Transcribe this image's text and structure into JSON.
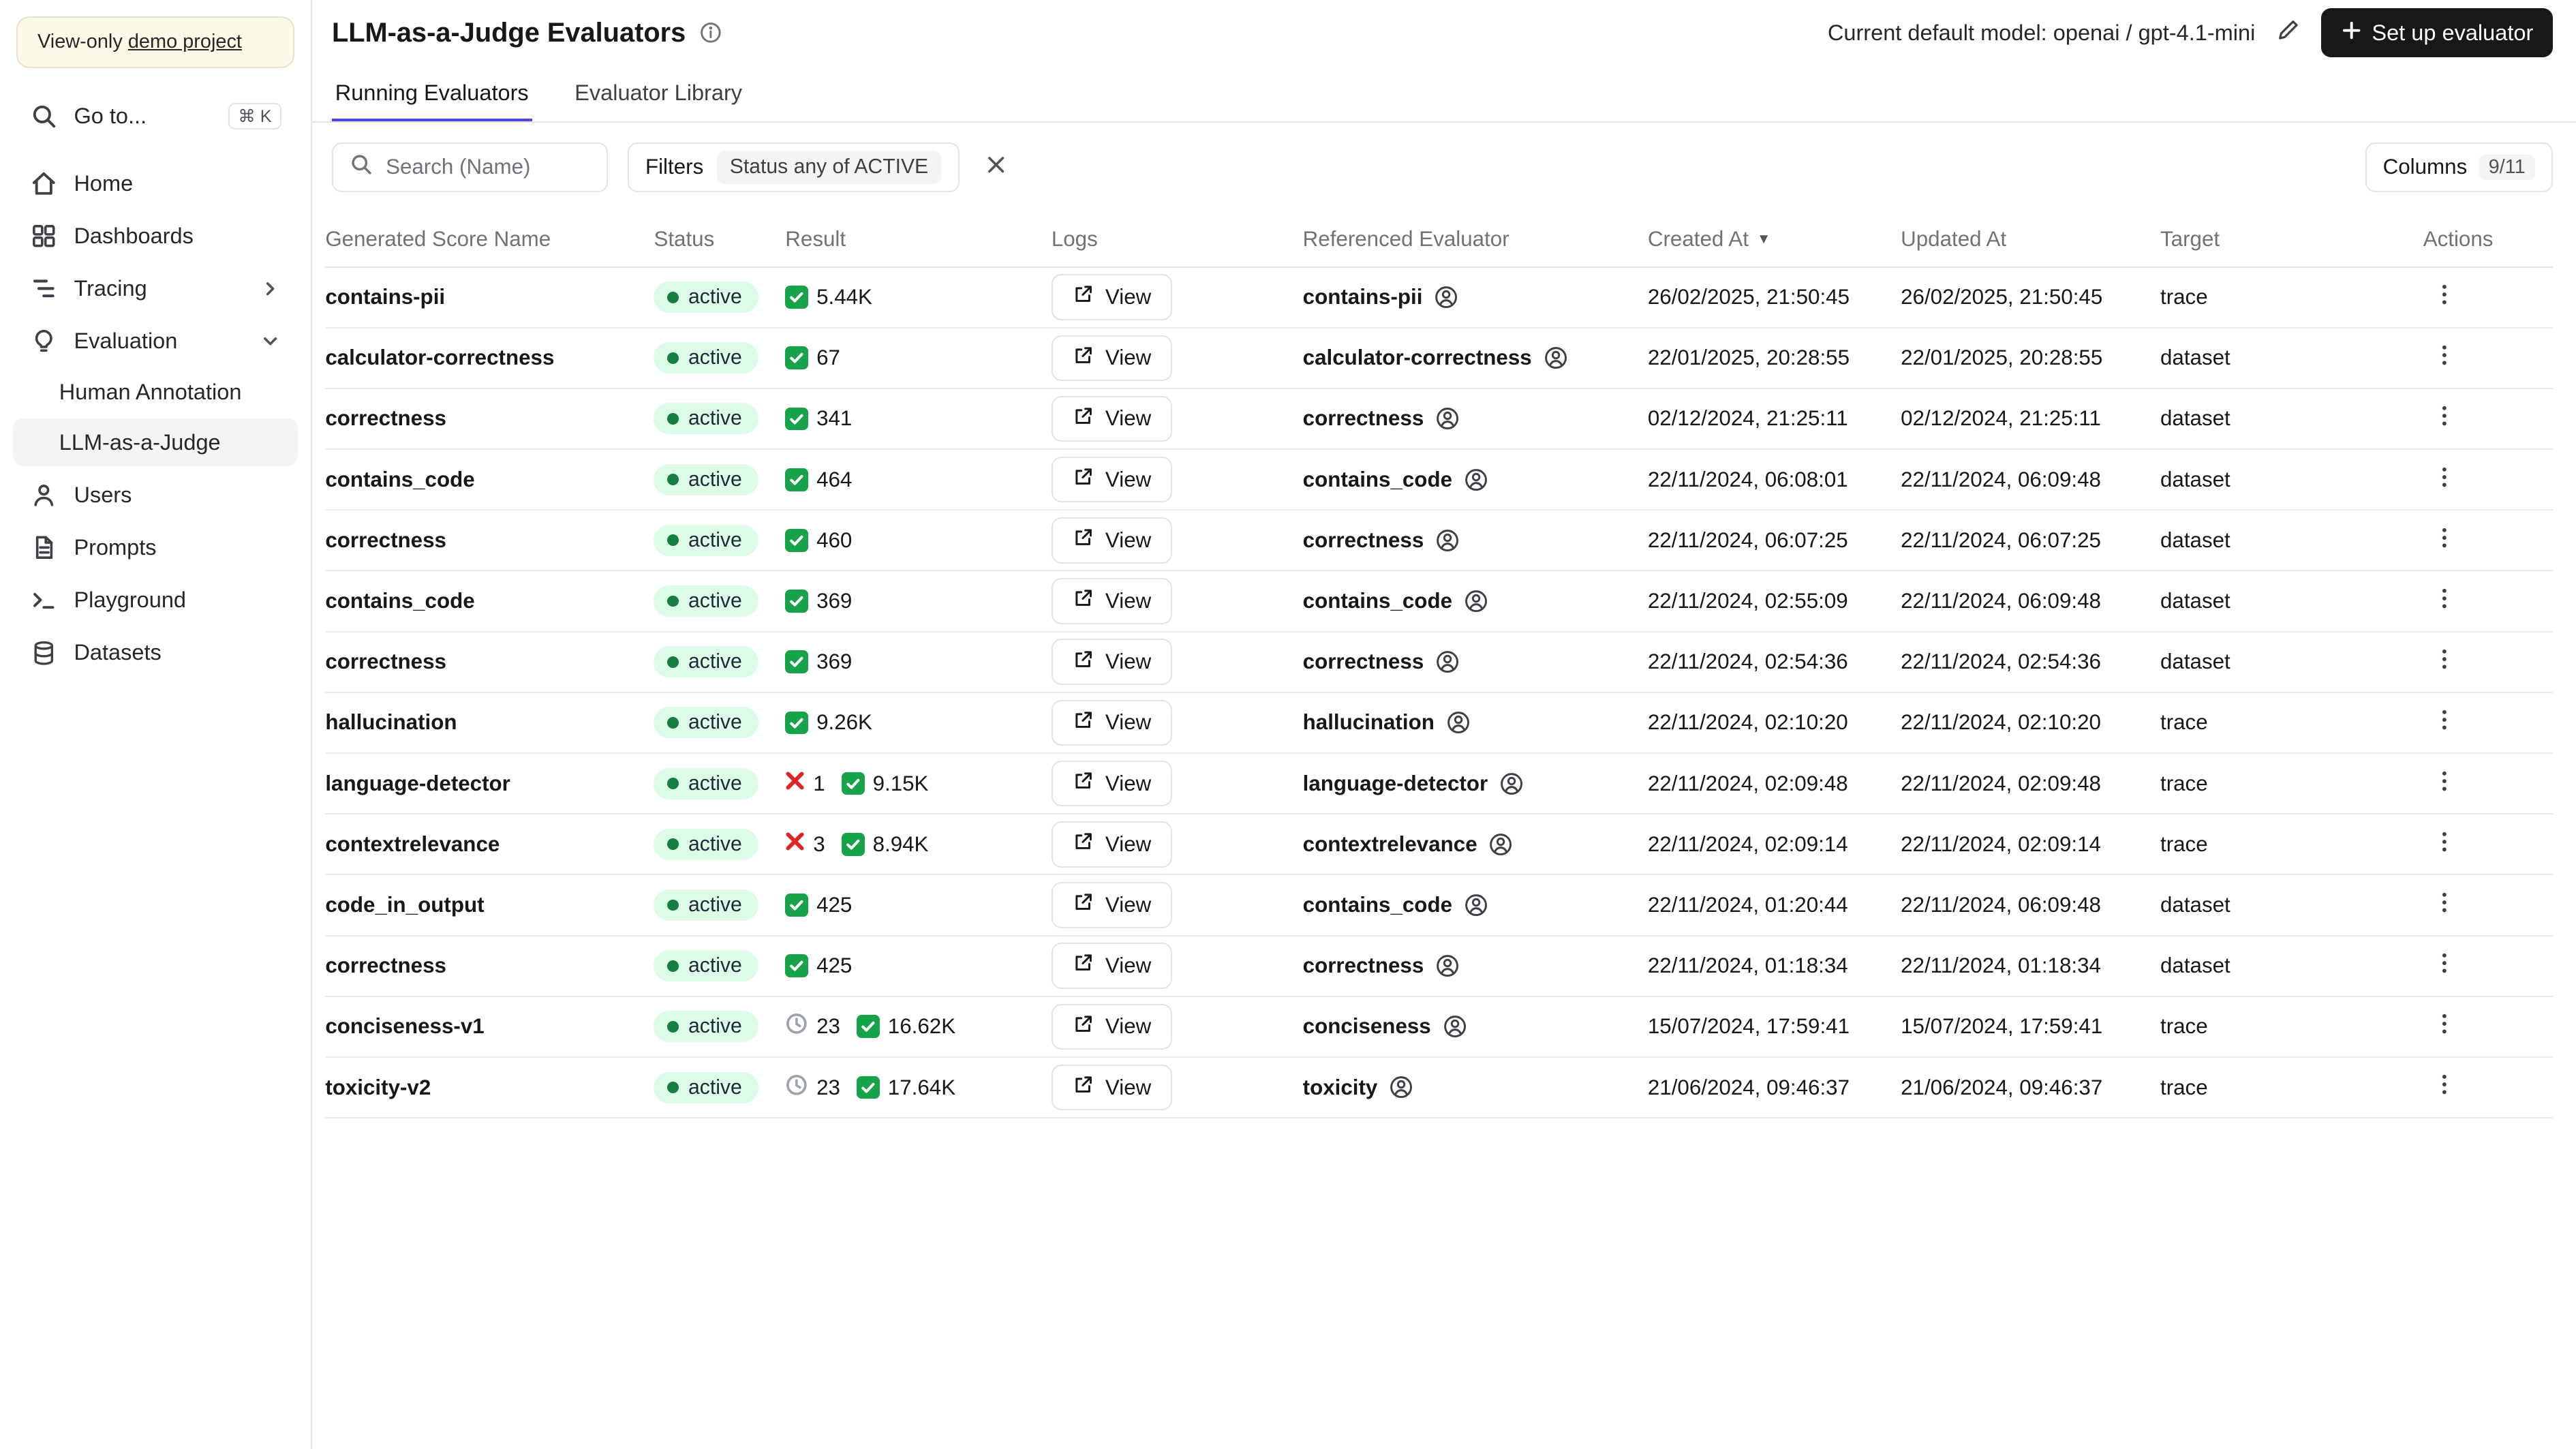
{
  "sidebar": {
    "banner_prefix": "View-only",
    "banner_link": "demo project",
    "goto_label": "Go to...",
    "goto_shortcut": "⌘ K",
    "items": [
      {
        "label": "Home"
      },
      {
        "label": "Dashboards"
      },
      {
        "label": "Tracing"
      },
      {
        "label": "Evaluation"
      },
      {
        "label": "Users"
      },
      {
        "label": "Prompts"
      },
      {
        "label": "Playground"
      },
      {
        "label": "Datasets"
      }
    ],
    "evaluation_children": [
      {
        "label": "Human Annotation",
        "active": false
      },
      {
        "label": "LLM-as-a-Judge",
        "active": true
      }
    ]
  },
  "header": {
    "title": "LLM-as-a-Judge Evaluators",
    "default_model_label": "Current default model: openai / gpt-4.1-mini",
    "setup_button_label": "Set up evaluator"
  },
  "tabs": [
    {
      "label": "Running Evaluators",
      "active": true
    },
    {
      "label": "Evaluator Library",
      "active": false
    }
  ],
  "toolbar": {
    "search_placeholder": "Search (Name)",
    "filters_label": "Filters",
    "filter_badge": "Status any of ACTIVE",
    "columns_label": "Columns",
    "columns_count": "9/11"
  },
  "table": {
    "columns": [
      "Generated Score Name",
      "Status",
      "Result",
      "Logs",
      "Referenced Evaluator",
      "Created At",
      "Updated At",
      "Target",
      "Actions"
    ],
    "sort_indicator": "▼",
    "rows": [
      {
        "name": "contains-pii",
        "status": "active",
        "result": {
          "success": "5.44K"
        },
        "logs": "View",
        "evaluator": "contains-pii",
        "created": "26/02/2025, 21:50:45",
        "updated": "26/02/2025, 21:50:45",
        "target": "trace"
      },
      {
        "name": "calculator-correctness",
        "status": "active",
        "result": {
          "success": "67"
        },
        "logs": "View",
        "evaluator": "calculator-correctness",
        "created": "22/01/2025, 20:28:55",
        "updated": "22/01/2025, 20:28:55",
        "target": "dataset"
      },
      {
        "name": "correctness",
        "status": "active",
        "result": {
          "success": "341"
        },
        "logs": "View",
        "evaluator": "correctness",
        "created": "02/12/2024, 21:25:11",
        "updated": "02/12/2024, 21:25:11",
        "target": "dataset"
      },
      {
        "name": "contains_code",
        "status": "active",
        "result": {
          "success": "464"
        },
        "logs": "View",
        "evaluator": "contains_code",
        "created": "22/11/2024, 06:08:01",
        "updated": "22/11/2024, 06:09:48",
        "target": "dataset"
      },
      {
        "name": "correctness",
        "status": "active",
        "result": {
          "success": "460"
        },
        "logs": "View",
        "evaluator": "correctness",
        "created": "22/11/2024, 06:07:25",
        "updated": "22/11/2024, 06:07:25",
        "target": "dataset"
      },
      {
        "name": "contains_code",
        "status": "active",
        "result": {
          "success": "369"
        },
        "logs": "View",
        "evaluator": "contains_code",
        "created": "22/11/2024, 02:55:09",
        "updated": "22/11/2024, 06:09:48",
        "target": "dataset"
      },
      {
        "name": "correctness",
        "status": "active",
        "result": {
          "success": "369"
        },
        "logs": "View",
        "evaluator": "correctness",
        "created": "22/11/2024, 02:54:36",
        "updated": "22/11/2024, 02:54:36",
        "target": "dataset"
      },
      {
        "name": "hallucination",
        "status": "active",
        "result": {
          "success": "9.26K"
        },
        "logs": "View",
        "evaluator": "hallucination",
        "created": "22/11/2024, 02:10:20",
        "updated": "22/11/2024, 02:10:20",
        "target": "trace"
      },
      {
        "name": "language-detector",
        "status": "active",
        "result": {
          "error": "1",
          "success": "9.15K"
        },
        "logs": "View",
        "evaluator": "language-detector",
        "created": "22/11/2024, 02:09:48",
        "updated": "22/11/2024, 02:09:48",
        "target": "trace"
      },
      {
        "name": "contextrelevance",
        "status": "active",
        "result": {
          "error": "3",
          "success": "8.94K"
        },
        "logs": "View",
        "evaluator": "contextrelevance",
        "created": "22/11/2024, 02:09:14",
        "updated": "22/11/2024, 02:09:14",
        "target": "trace"
      },
      {
        "name": "code_in_output",
        "status": "active",
        "result": {
          "success": "425"
        },
        "logs": "View",
        "evaluator": "contains_code",
        "created": "22/11/2024, 01:20:44",
        "updated": "22/11/2024, 06:09:48",
        "target": "dataset"
      },
      {
        "name": "correctness",
        "status": "active",
        "result": {
          "success": "425"
        },
        "logs": "View",
        "evaluator": "correctness",
        "created": "22/11/2024, 01:18:34",
        "updated": "22/11/2024, 01:18:34",
        "target": "dataset"
      },
      {
        "name": "conciseness-v1",
        "status": "active",
        "result": {
          "pending": "23",
          "success": "16.62K"
        },
        "logs": "View",
        "evaluator": "conciseness",
        "created": "15/07/2024, 17:59:41",
        "updated": "15/07/2024, 17:59:41",
        "target": "trace"
      },
      {
        "name": "toxicity-v2",
        "status": "active",
        "result": {
          "pending": "23",
          "success": "17.64K"
        },
        "logs": "View",
        "evaluator": "toxicity",
        "created": "21/06/2024, 09:46:37",
        "updated": "21/06/2024, 09:46:37",
        "target": "trace"
      }
    ]
  }
}
